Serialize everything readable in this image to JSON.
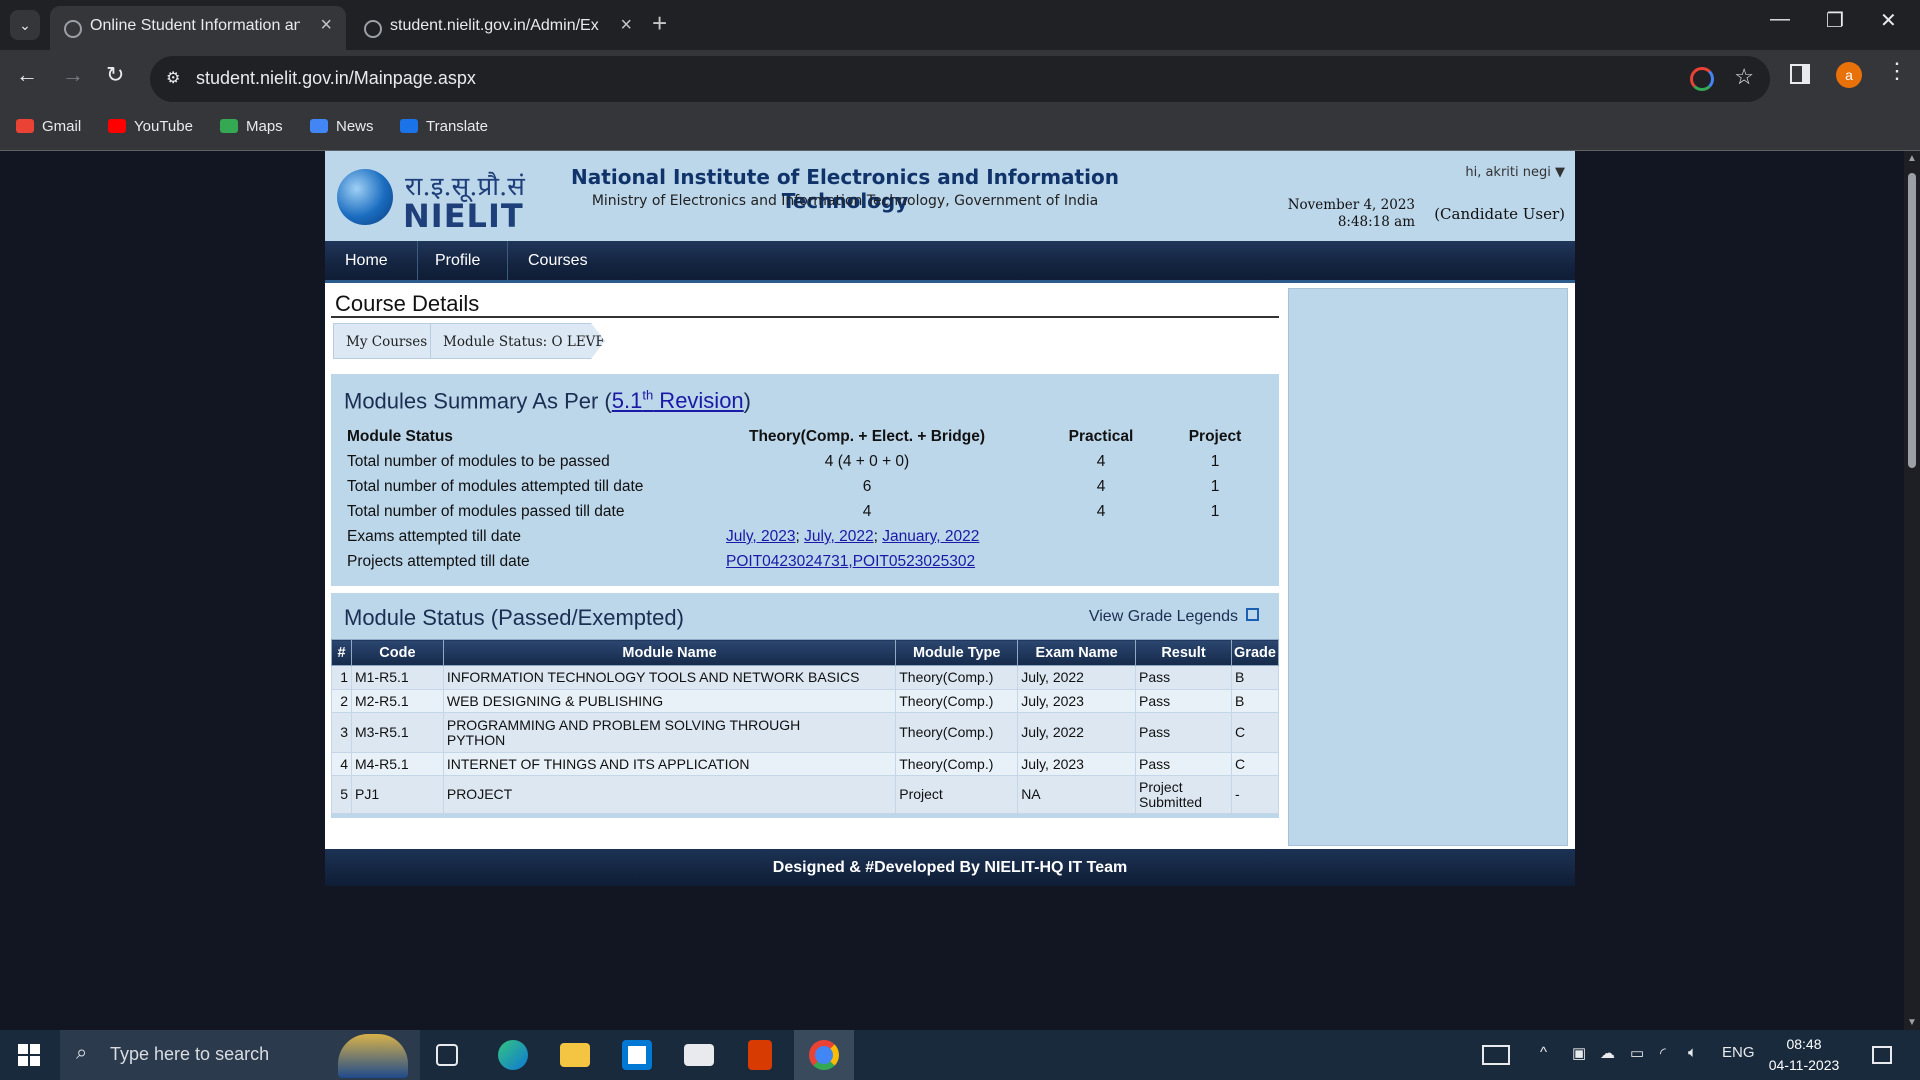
{
  "browser": {
    "tabs": [
      {
        "title": "Online Student Information an",
        "active": true
      },
      {
        "title": "student.nielit.gov.in/Admin/Ex",
        "active": false
      }
    ],
    "url": "student.nielit.gov.in/Mainpage.aspx",
    "avatar_letter": "a",
    "bookmarks": [
      "Gmail",
      "YouTube",
      "Maps",
      "News",
      "Translate"
    ]
  },
  "header": {
    "logo_hindi": "रा.इ.सू.प्रौ.सं",
    "logo_text": "NIELIT",
    "org_title": "National Institute of Electronics and Information Technology",
    "org_subtitle": "Ministry of Electronics and Information Technology, Government of India",
    "greeting": "hi, akriti negi",
    "date": "November 4, 2023",
    "time": "8:48:18 am",
    "role": "(Candidate User)"
  },
  "nav": [
    "Home",
    "Profile",
    "Courses"
  ],
  "content": {
    "title": "Course Details",
    "breadcrumb": [
      "My Courses",
      "Module Status: O LEVEL"
    ]
  },
  "summary": {
    "title_prefix": "Modules Summary As Per (",
    "revision_link": "5.1",
    "revision_sup": "th",
    "revision_suffix": " Revision",
    "title_end": ")",
    "headers": [
      "Module Status",
      "Theory(Comp. + Elect. + Bridge)",
      "Practical",
      "Project"
    ],
    "rows": [
      {
        "label": "Total number of modules to be passed",
        "theory": "4 (4 + 0 + 0)",
        "practical": "4",
        "project": "1"
      },
      {
        "label": "Total number of modules attempted till date",
        "theory": "6",
        "practical": "4",
        "project": "1"
      },
      {
        "label": "Total number of modules passed till date",
        "theory": "4",
        "practical": "4",
        "project": "1"
      }
    ],
    "exams_label": "Exams attempted till date",
    "exams": [
      "July, 2023",
      "July, 2022",
      "January, 2022"
    ],
    "projects_label": "Projects attempted till date",
    "projects": [
      "POIT0423024731",
      "POIT0523025302"
    ]
  },
  "module_status": {
    "title": "Module Status (Passed/Exempted)",
    "legends_link": "View Grade Legends",
    "columns": [
      "#",
      "Code",
      "Module Name",
      "Module Type",
      "Exam Name",
      "Result",
      "Grade"
    ],
    "rows": [
      {
        "n": "1",
        "code": "M1-R5.1",
        "name": "INFORMATION TECHNOLOGY TOOLS AND NETWORK BASICS",
        "type": "Theory(Comp.)",
        "exam": "July, 2022",
        "result": "Pass",
        "grade": "B"
      },
      {
        "n": "2",
        "code": "M2-R5.1",
        "name": "WEB DESIGNING & PUBLISHING",
        "type": "Theory(Comp.)",
        "exam": "July, 2023",
        "result": "Pass",
        "grade": "B"
      },
      {
        "n": "3",
        "code": "M3-R5.1",
        "name": "PROGRAMMING AND PROBLEM SOLVING THROUGH PYTHON",
        "type": "Theory(Comp.)",
        "exam": "July, 2022",
        "result": "Pass",
        "grade": "C"
      },
      {
        "n": "4",
        "code": "M4-R5.1",
        "name": "INTERNET OF THINGS AND ITS APPLICATION",
        "type": "Theory(Comp.)",
        "exam": "July, 2023",
        "result": "Pass",
        "grade": "C"
      },
      {
        "n": "5",
        "code": "PJ1",
        "name": "PROJECT",
        "type": "Project",
        "exam": "NA",
        "result": "Project Submitted",
        "grade": "-"
      }
    ]
  },
  "footer": "Designed & #Developed By NIELIT-HQ IT Team",
  "taskbar": {
    "search_placeholder": "Type here to search",
    "language": "ENG",
    "time": "08:48",
    "date": "04-11-2023"
  },
  "colors": {
    "header_bg": "#bcd6ea",
    "nav_bg": "#142440",
    "link": "#1a1aa6",
    "accent_avatar": "#e8710a"
  }
}
